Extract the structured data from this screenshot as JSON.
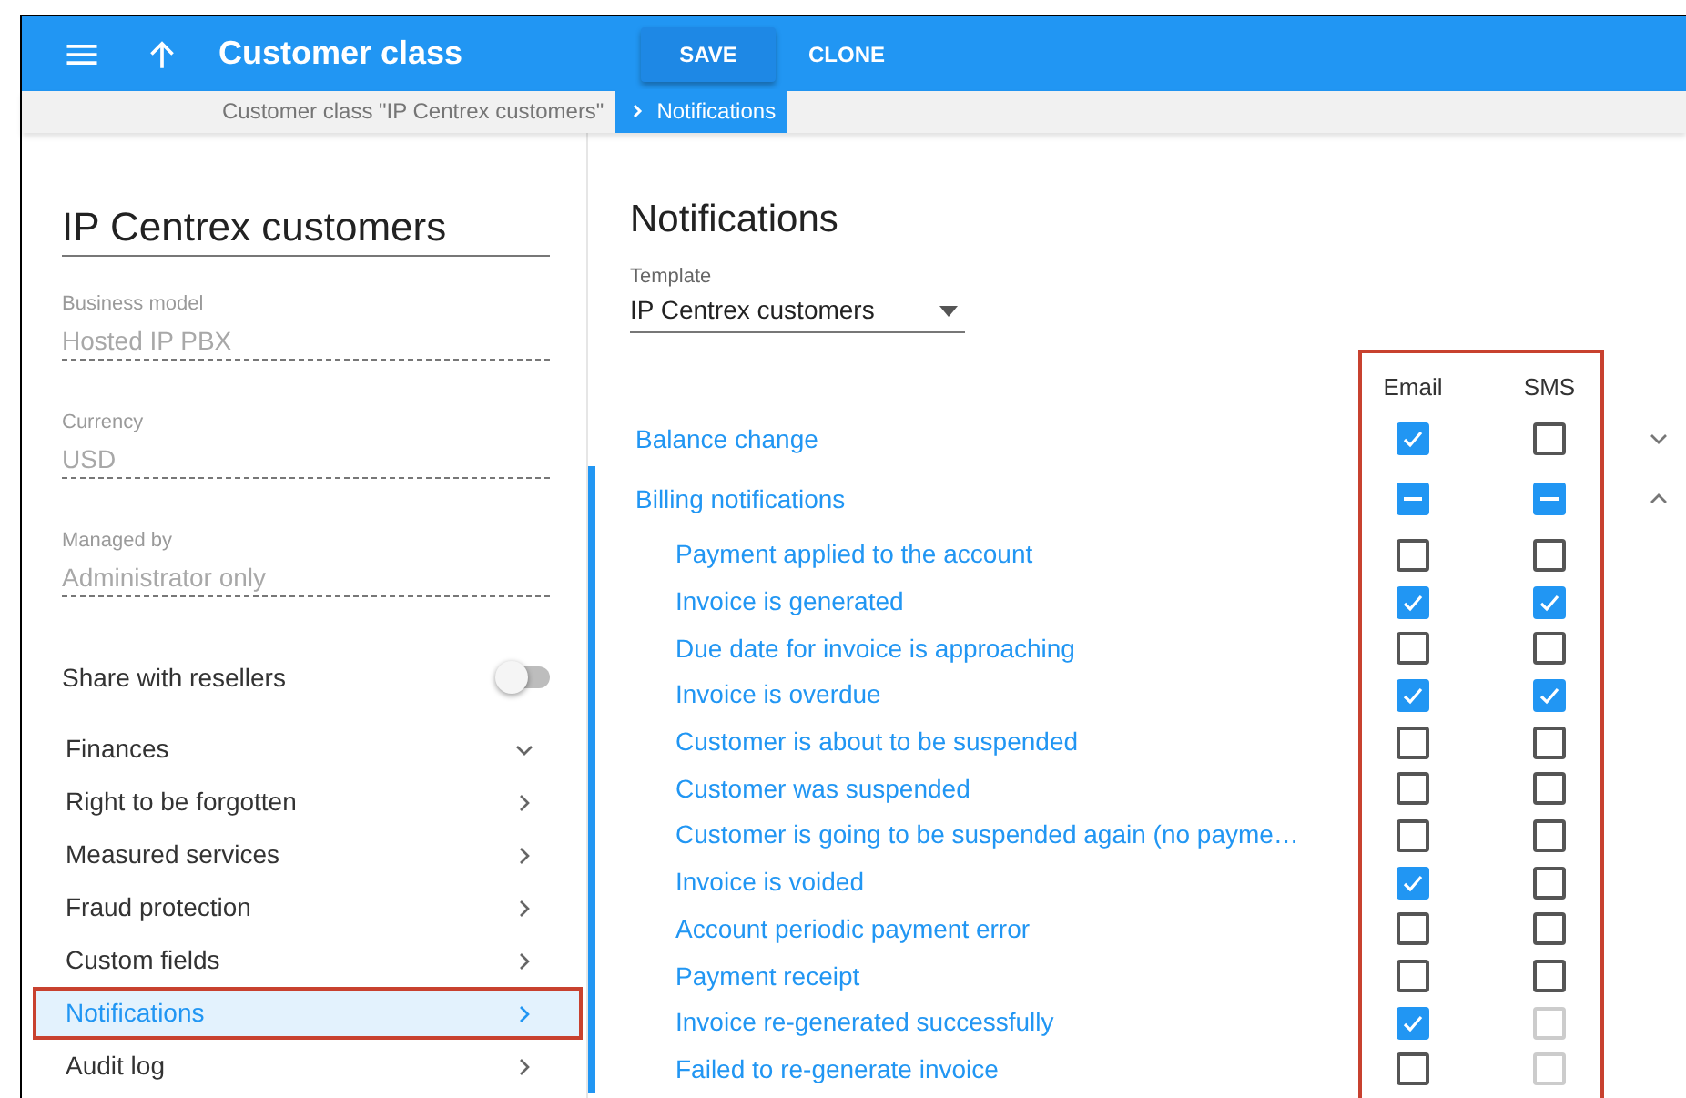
{
  "header": {
    "title": "Customer class",
    "buttons": [
      {
        "label": "SAVE",
        "kind": "raised"
      },
      {
        "label": "CLONE",
        "kind": "flat"
      }
    ]
  },
  "breadcrumb": [
    {
      "label": "Customer class \"IP Centrex customers\"",
      "selected": false
    },
    {
      "label": "Notifications",
      "selected": true
    }
  ],
  "sidebar": {
    "title": "IP Centrex customers",
    "fields": [
      {
        "label": "Business model",
        "value": "Hosted IP PBX",
        "disabled": true
      },
      {
        "label": "Currency",
        "value": "USD",
        "disabled": true
      },
      {
        "label": "Managed by",
        "value": "Administrator only",
        "disabled": true
      }
    ],
    "share": {
      "label": "Share with resellers",
      "on": false
    },
    "items": [
      {
        "label": "Finances",
        "expanded": true,
        "selected": false,
        "highlighted": false
      },
      {
        "label": "Right to be forgotten",
        "expanded": false,
        "selected": false,
        "highlighted": false
      },
      {
        "label": "Measured services",
        "expanded": false,
        "selected": false,
        "highlighted": false
      },
      {
        "label": "Fraud protection",
        "expanded": false,
        "selected": false,
        "highlighted": false
      },
      {
        "label": "Custom fields",
        "expanded": false,
        "selected": false,
        "highlighted": false
      },
      {
        "label": "Notifications",
        "expanded": false,
        "selected": true,
        "highlighted": true
      },
      {
        "label": "Audit log",
        "expanded": false,
        "selected": false,
        "highlighted": false
      }
    ]
  },
  "content": {
    "title": "Notifications",
    "template": {
      "label": "Template",
      "value": "IP Centrex customers"
    },
    "columns": [
      "Email",
      "SMS"
    ],
    "columns_highlighted": true,
    "groups": [
      {
        "label": "Balance change",
        "expanded": false,
        "email": {
          "checked": true,
          "disabled": false
        },
        "sms": {
          "checked": false,
          "disabled": false
        }
      },
      {
        "label": "Billing notifications",
        "expanded": true,
        "email": {
          "checked": true,
          "mixed": true,
          "disabled": false
        },
        "sms": {
          "checked": true,
          "mixed": true,
          "disabled": false
        },
        "children": [
          {
            "label": "Payment applied to the account",
            "email": {
              "checked": false,
              "disabled": false
            },
            "sms": {
              "checked": false,
              "disabled": false
            }
          },
          {
            "label": "Invoice is generated",
            "email": {
              "checked": true,
              "disabled": false
            },
            "sms": {
              "checked": true,
              "disabled": false
            }
          },
          {
            "label": "Due date for invoice is approaching",
            "email": {
              "checked": false,
              "disabled": false
            },
            "sms": {
              "checked": false,
              "disabled": false
            }
          },
          {
            "label": "Invoice is overdue",
            "email": {
              "checked": true,
              "disabled": false
            },
            "sms": {
              "checked": true,
              "disabled": false
            }
          },
          {
            "label": "Customer is about to be suspended",
            "email": {
              "checked": false,
              "disabled": false
            },
            "sms": {
              "checked": false,
              "disabled": false
            }
          },
          {
            "label": "Customer was suspended",
            "email": {
              "checked": false,
              "disabled": false
            },
            "sms": {
              "checked": false,
              "disabled": false
            }
          },
          {
            "label": "Customer is going to be suspended again (no payme…",
            "email": {
              "checked": false,
              "disabled": false
            },
            "sms": {
              "checked": false,
              "disabled": false
            }
          },
          {
            "label": "Invoice is voided",
            "email": {
              "checked": true,
              "disabled": false
            },
            "sms": {
              "checked": false,
              "disabled": false
            }
          },
          {
            "label": "Account periodic payment error",
            "email": {
              "checked": false,
              "disabled": false
            },
            "sms": {
              "checked": false,
              "disabled": false
            }
          },
          {
            "label": "Payment receipt",
            "email": {
              "checked": false,
              "disabled": false
            },
            "sms": {
              "checked": false,
              "disabled": false
            }
          },
          {
            "label": "Invoice re-generated successfully",
            "email": {
              "checked": true,
              "disabled": false
            },
            "sms": {
              "checked": false,
              "disabled": true
            }
          },
          {
            "label": "Failed to re-generate invoice",
            "email": {
              "checked": false,
              "disabled": false
            },
            "sms": {
              "checked": false,
              "disabled": true
            }
          }
        ]
      }
    ]
  }
}
